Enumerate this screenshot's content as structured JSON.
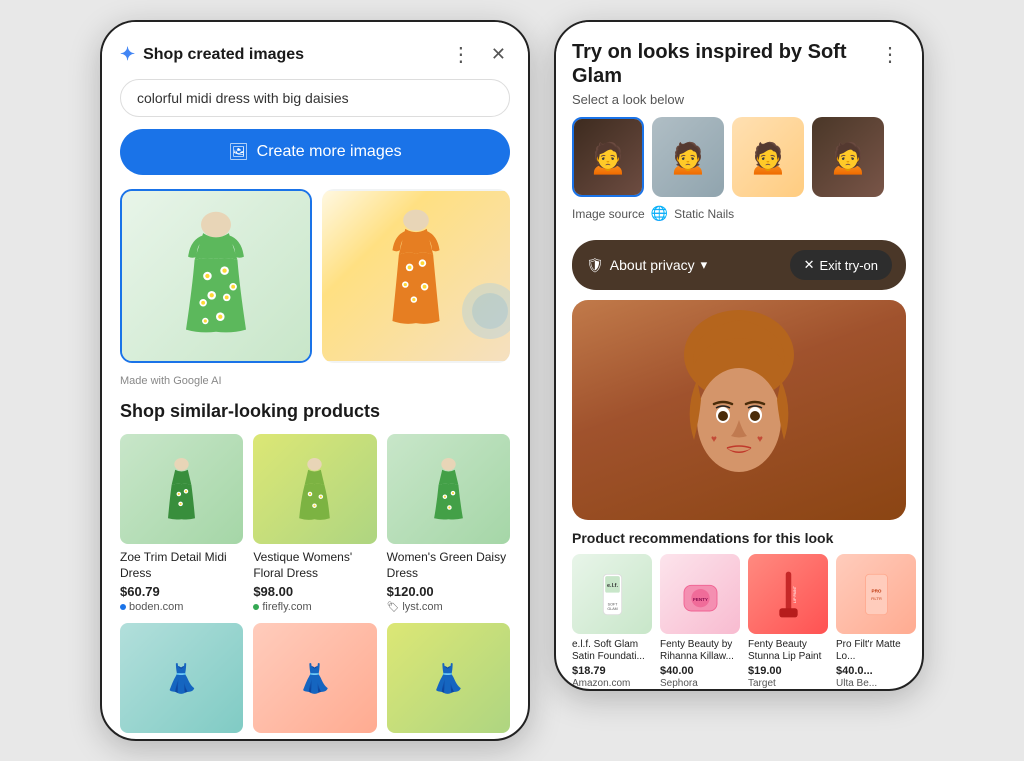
{
  "left_phone": {
    "header": {
      "title": "Shop created images",
      "more_label": "⋮",
      "close_label": "✕"
    },
    "search": {
      "value": "colorful midi dress with big daisies"
    },
    "create_button": {
      "label": "Create more images",
      "icon": "🖼"
    },
    "made_with": "Made with Google AI",
    "shop_similar_title": "Shop similar-looking products",
    "products": [
      {
        "name": "Zoe Trim Detail Midi Dress",
        "price": "$60.79",
        "store": "boden.com",
        "store_color": "blue"
      },
      {
        "name": "Vestique Womens' Floral Dress",
        "price": "$98.00",
        "store": "firefly.com",
        "store_color": "green"
      },
      {
        "name": "Women's Green Daisy Dress",
        "price": "$120.00",
        "store": "lyst.com",
        "store_color": "orange"
      }
    ]
  },
  "right_phone": {
    "header": {
      "title": "Try on looks inspired by Soft Glam",
      "subtitle": "Select a look below",
      "more_label": "⋮"
    },
    "image_source": {
      "label": "Image source",
      "source_name": "Static Nails"
    },
    "privacy_bar": {
      "label": "About privacy",
      "chevron": "▾",
      "exit_label": "Exit try-on",
      "exit_icon": "✕"
    },
    "product_recs_title": "Product recommendations for this look",
    "beauty_products": [
      {
        "name": "e.l.f. Soft Glam Satin Foundati...",
        "price": "$18.79",
        "store": "Amazon.com"
      },
      {
        "name": "Fenty Beauty by Rihanna Killaw...",
        "price": "$40.00",
        "store": "Sephora"
      },
      {
        "name": "Fenty Beauty Stunna Lip Paint",
        "price": "$19.00",
        "store": "Target"
      },
      {
        "name": "Pro Filt'r Matte Lo...",
        "price": "$40.0...",
        "store": "Ulta Be..."
      }
    ]
  }
}
